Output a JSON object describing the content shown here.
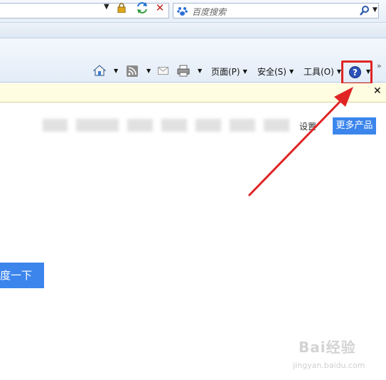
{
  "search": {
    "placeholder": "百度搜索"
  },
  "toolbar": {
    "page_label": "页面(P)",
    "safety_label": "安全(S)",
    "tools_label": "工具(O)"
  },
  "content": {
    "settings_fragment": "设置",
    "more_products": "更多产品",
    "search_button": "度一下"
  },
  "watermark": {
    "logo": "Bai经验",
    "url": "jingyan.baidu.com"
  },
  "icons": [
    "lock-icon",
    "refresh-icon",
    "stop-icon",
    "paw-icon",
    "search-go-icon",
    "home-icon",
    "rss-icon",
    "mail-icon",
    "print-icon",
    "help-icon",
    "close-icon"
  ],
  "colors": {
    "accent_blue": "#3b85ec",
    "highlight_red": "#e02424",
    "info_bar": "#fffde1"
  }
}
